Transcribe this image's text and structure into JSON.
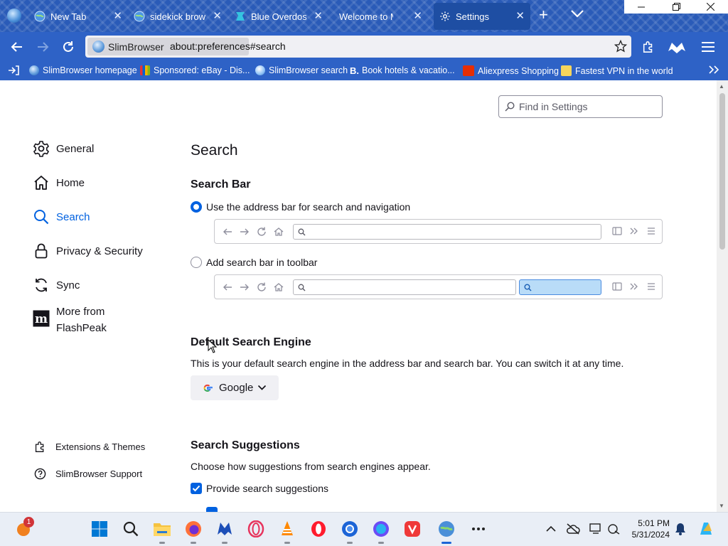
{
  "browser": {
    "tabs": [
      {
        "label": "New Tab"
      },
      {
        "label": "sidekick browser"
      },
      {
        "label": "Blue Overdose"
      },
      {
        "label": "Welcome to Malwarebytes"
      },
      {
        "label": "Settings"
      }
    ],
    "url": "about:preferences#search",
    "identity_label": "SlimBrowser",
    "bookmarks": [
      "SlimBrowser homepage",
      "Sponsored: eBay - Dis...",
      "SlimBrowser search",
      "Book hotels & vacatio...",
      "Aliexpress Shopping",
      "Fastest VPN in the world"
    ]
  },
  "settings": {
    "find_placeholder": "Find in Settings",
    "nav": [
      {
        "label": "General",
        "icon": "gear-icon"
      },
      {
        "label": "Home",
        "icon": "home-icon"
      },
      {
        "label": "Search",
        "icon": "search-icon"
      },
      {
        "label": "Privacy & Security",
        "icon": "lock-icon"
      },
      {
        "label": "Sync",
        "icon": "sync-icon"
      },
      {
        "label": "More from FlashPeak",
        "icon": "flashpeak-icon"
      }
    ],
    "nav_bottom": [
      {
        "label": "Extensions & Themes",
        "icon": "puzzle-icon"
      },
      {
        "label": "SlimBrowser Support",
        "icon": "help-icon"
      }
    ],
    "page_title": "Search",
    "search_bar": {
      "heading": "Search Bar",
      "option_address": "Use the address bar for search and navigation",
      "option_toolbar": "Add search bar in toolbar",
      "selected": "address"
    },
    "default_engine": {
      "heading": "Default Search Engine",
      "description": "This is your default search engine in the address bar and search bar. You can switch it at any time.",
      "selected": "Google"
    },
    "suggestions": {
      "heading": "Search Suggestions",
      "description": "Choose how suggestions from search engines appear.",
      "provide_label": "Provide search suggestions",
      "provide_checked": true
    }
  },
  "taskbar": {
    "time": "5:01 PM",
    "date": "5/31/2024",
    "notification_count": "1"
  },
  "colors": {
    "accent": "#0061e0",
    "toolbar": "#2e62c6",
    "tabstrip": "#2a5bb8"
  }
}
